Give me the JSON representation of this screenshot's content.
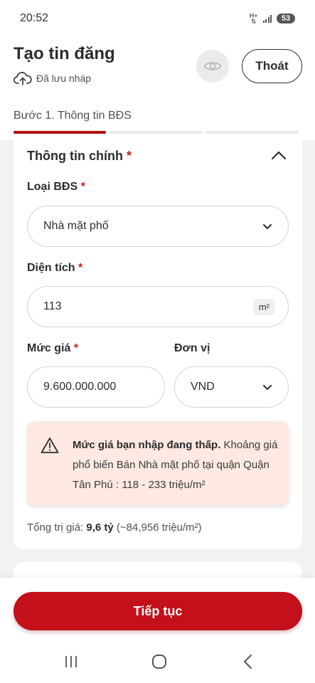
{
  "status_bar": {
    "time": "20:52",
    "network": "H+",
    "battery": "53"
  },
  "header": {
    "title": "Tạo tin đăng",
    "save_status": "Đã lưu nháp",
    "exit_label": "Thoát",
    "step_label": "Bước 1. Thông tin BĐS",
    "progress_steps": 3,
    "active_step": 1
  },
  "section": {
    "title": "Thông tin chính",
    "required_mark": "*"
  },
  "fields": {
    "property_type": {
      "label": "Loại BĐS",
      "value": "Nhà mặt phố"
    },
    "area": {
      "label": "Diện tích",
      "value": "113",
      "unit": "m²"
    },
    "price": {
      "label": "Mức giá",
      "value": "9.600.000.000"
    },
    "unit": {
      "label": "Đơn vị",
      "value": "VND"
    }
  },
  "warning": {
    "bold": "Mức giá bạn nhập đang thấp.",
    "text": " Khoảng giá phổ biến Bán Nhà mặt phố tại quận Quận Tân Phú : 118 - 233 triệu/m²"
  },
  "total": {
    "label": "Tổng trị giá: ",
    "value": "9,6 tỷ",
    "per_m2": " (~84,956 triệu/m²)"
  },
  "footer": {
    "continue_label": "Tiếp tục"
  },
  "colors": {
    "accent": "#c3101a",
    "warning_bg": "#fde9e2",
    "required": "#c71a1a"
  },
  "icons": [
    "cloud-upload-icon",
    "eye-icon",
    "chevron-up-icon",
    "chevron-down-icon",
    "warning-triangle-icon",
    "recents-icon",
    "home-icon",
    "back-icon"
  ]
}
